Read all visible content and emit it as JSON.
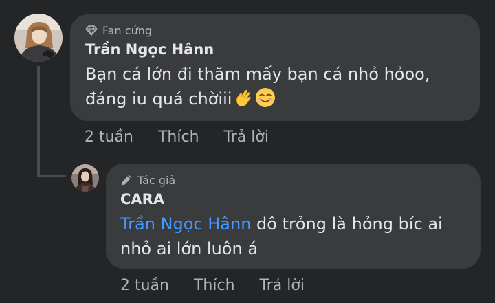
{
  "comments": [
    {
      "badge": "Fan cứng",
      "badge_icon": "diamond-icon",
      "author": "Trần Ngọc Hânn",
      "text_line1": "Bạn cá lớn đi thăm mấy bạn cá nhỏ hỏoo,",
      "text_line2": "đáng iu quá chờiii",
      "emojis": [
        "pinched-fingers-emoji",
        "smiling-face-emoji"
      ],
      "time": "2 tuần",
      "like_label": "Thích",
      "reply_label": "Trả lời"
    },
    {
      "badge": "Tác giả",
      "badge_icon": "pen-icon",
      "author": "CARA",
      "mention": "Trần Ngọc Hânn",
      "text_line1_rest": " dô trỏng là hỏng bíc ai",
      "text_line2": "nhỏ ai lớn luôn á",
      "time": "2 tuần",
      "like_label": "Thích",
      "reply_label": "Trả lời"
    }
  ],
  "colors": {
    "background": "#242526",
    "bubble": "#3a3b3c",
    "text": "#e4e6eb",
    "secondary_text": "#b0b3b8",
    "mention": "#4599ff"
  }
}
